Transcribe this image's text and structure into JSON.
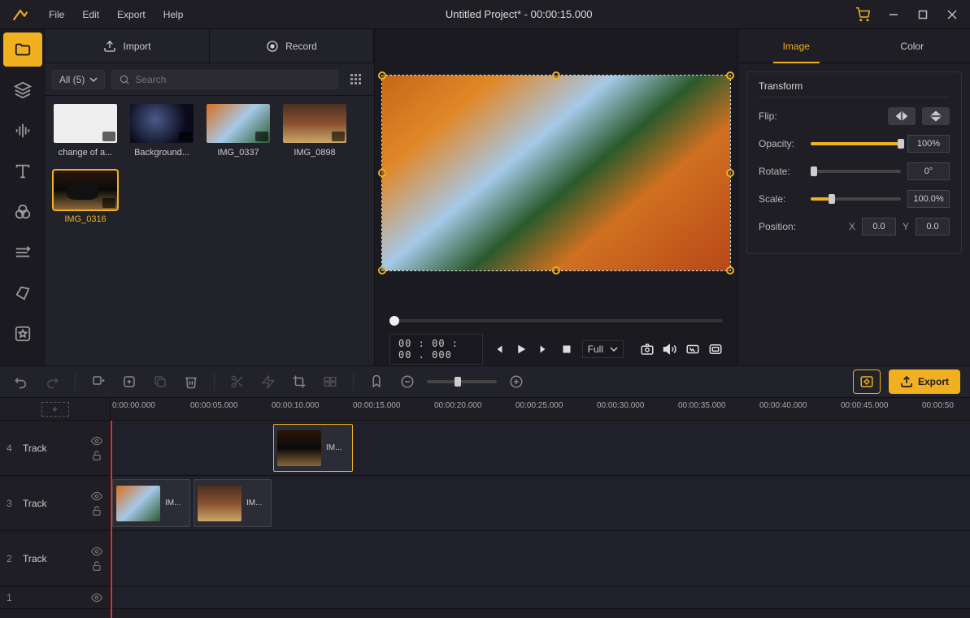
{
  "title": "Untitled Project* - 00:00:15.000",
  "menu": {
    "file": "File",
    "edit": "Edit",
    "export": "Export",
    "help": "Help"
  },
  "media": {
    "import": "Import",
    "record": "Record",
    "filter": "All (5)",
    "search_placeholder": "Search",
    "items": [
      {
        "label": "change of a..."
      },
      {
        "label": "Background..."
      },
      {
        "label": "IMG_0337"
      },
      {
        "label": "IMG_0898"
      },
      {
        "label": "IMG_0316"
      }
    ]
  },
  "preview": {
    "timecode": "00 : 00 : 00 . 000",
    "size_mode": "Full"
  },
  "props": {
    "tab_image": "Image",
    "tab_color": "Color",
    "section": "Transform",
    "flip": "Flip:",
    "opacity": "Opacity:",
    "opacity_val": "100%",
    "rotate": "Rotate:",
    "rotate_val": "0°",
    "scale": "Scale:",
    "scale_val": "100.0%",
    "position": "Position:",
    "pos_x_label": "X",
    "pos_x": "0.0",
    "pos_y_label": "Y",
    "pos_y": "0.0"
  },
  "timeline_toolbar": {
    "export_btn": "Export"
  },
  "ruler": [
    "0:00:00.000",
    "00:00:05.000",
    "00:00:10.000",
    "00:00:15.000",
    "00:00:20.000",
    "00:00:25.000",
    "00:00:30.000",
    "00:00:35.000",
    "00:00:40.000",
    "00:00:45.000",
    "00:00:50"
  ],
  "tracks": {
    "label": "Track",
    "t4": "4",
    "t3": "3",
    "t2": "2",
    "t1": "1",
    "clip4": "IM...",
    "clip3a": "IM...",
    "clip3b": "IM..."
  }
}
